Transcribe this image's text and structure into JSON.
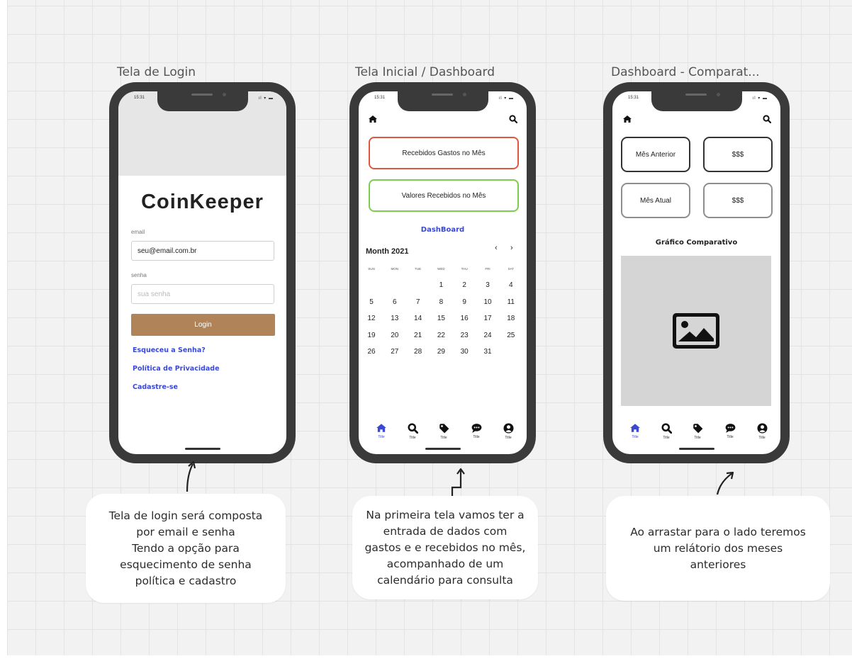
{
  "frames": [
    {
      "title": "Tela de Login"
    },
    {
      "title": "Tela Inicial / Dashboard"
    },
    {
      "title": "Dashboard - Comparat..."
    }
  ],
  "status": {
    "time": "15:31",
    "icons": "ıl ▾ ▬"
  },
  "login": {
    "brand": "CoinKeeper",
    "email_label": "email",
    "email_value": "seu@email.com.br",
    "password_label": "senha",
    "password_placeholder": "sua senha",
    "login_button": "Login",
    "links": {
      "forgot": "Esqueceu a Senha?",
      "privacy": "Política de Privacidade",
      "register": "Cadastre-se"
    }
  },
  "dashboard": {
    "card_spent": "Recebidos Gastos no Mês",
    "card_received": "Valores Recebidos no Mês",
    "section_link": "DashBoard",
    "calendar": {
      "month": "Month 2021",
      "prev": "‹",
      "next": "›",
      "weekdays": [
        "SUN",
        "MON",
        "TUE",
        "WED",
        "THU",
        "FRI",
        "SAT"
      ],
      "weeks": [
        [
          "",
          "",
          "",
          "1",
          "2",
          "3",
          "4"
        ],
        [
          "5",
          "6",
          "7",
          "8",
          "9",
          "10",
          "11"
        ],
        [
          "12",
          "13",
          "14",
          "15",
          "16",
          "17",
          "18"
        ],
        [
          "19",
          "20",
          "21",
          "22",
          "23",
          "24",
          "25"
        ],
        [
          "26",
          "27",
          "28",
          "29",
          "30",
          "31",
          ""
        ]
      ]
    }
  },
  "nav": {
    "items": [
      {
        "icon": "home-icon",
        "label": "Title"
      },
      {
        "icon": "search-icon",
        "label": "Title"
      },
      {
        "icon": "tag-icon",
        "label": "Title"
      },
      {
        "icon": "chat-icon",
        "label": "Title"
      },
      {
        "icon": "user-icon",
        "label": "Title"
      }
    ]
  },
  "comparativo": {
    "prev_month": "Mês Anterior",
    "prev_value": "$$$",
    "current_month": "Mês Atual",
    "current_value": "$$$",
    "chart_title": "Gráfico Comparativo"
  },
  "comments": {
    "login": "Tela de login será composta\npor email e senha\nTendo a opção para\nesquecimento de senha\npolítica e cadastro",
    "dashboard": "Na primeira tela vamos ter a\nentrada de dados com\ngastos e e recebidos no mês,\nacompanhado de um\ncalendário para consulta",
    "comparativo": "Ao arrastar para o lado teremos\num relátorio dos meses\nanteriores"
  },
  "colors": {
    "accent": "#3949d6",
    "login_button": "#b08458",
    "card_spent_border": "#e0553f",
    "card_received_border": "#7ccc4f",
    "phone_frame": "#3a3a3a"
  }
}
